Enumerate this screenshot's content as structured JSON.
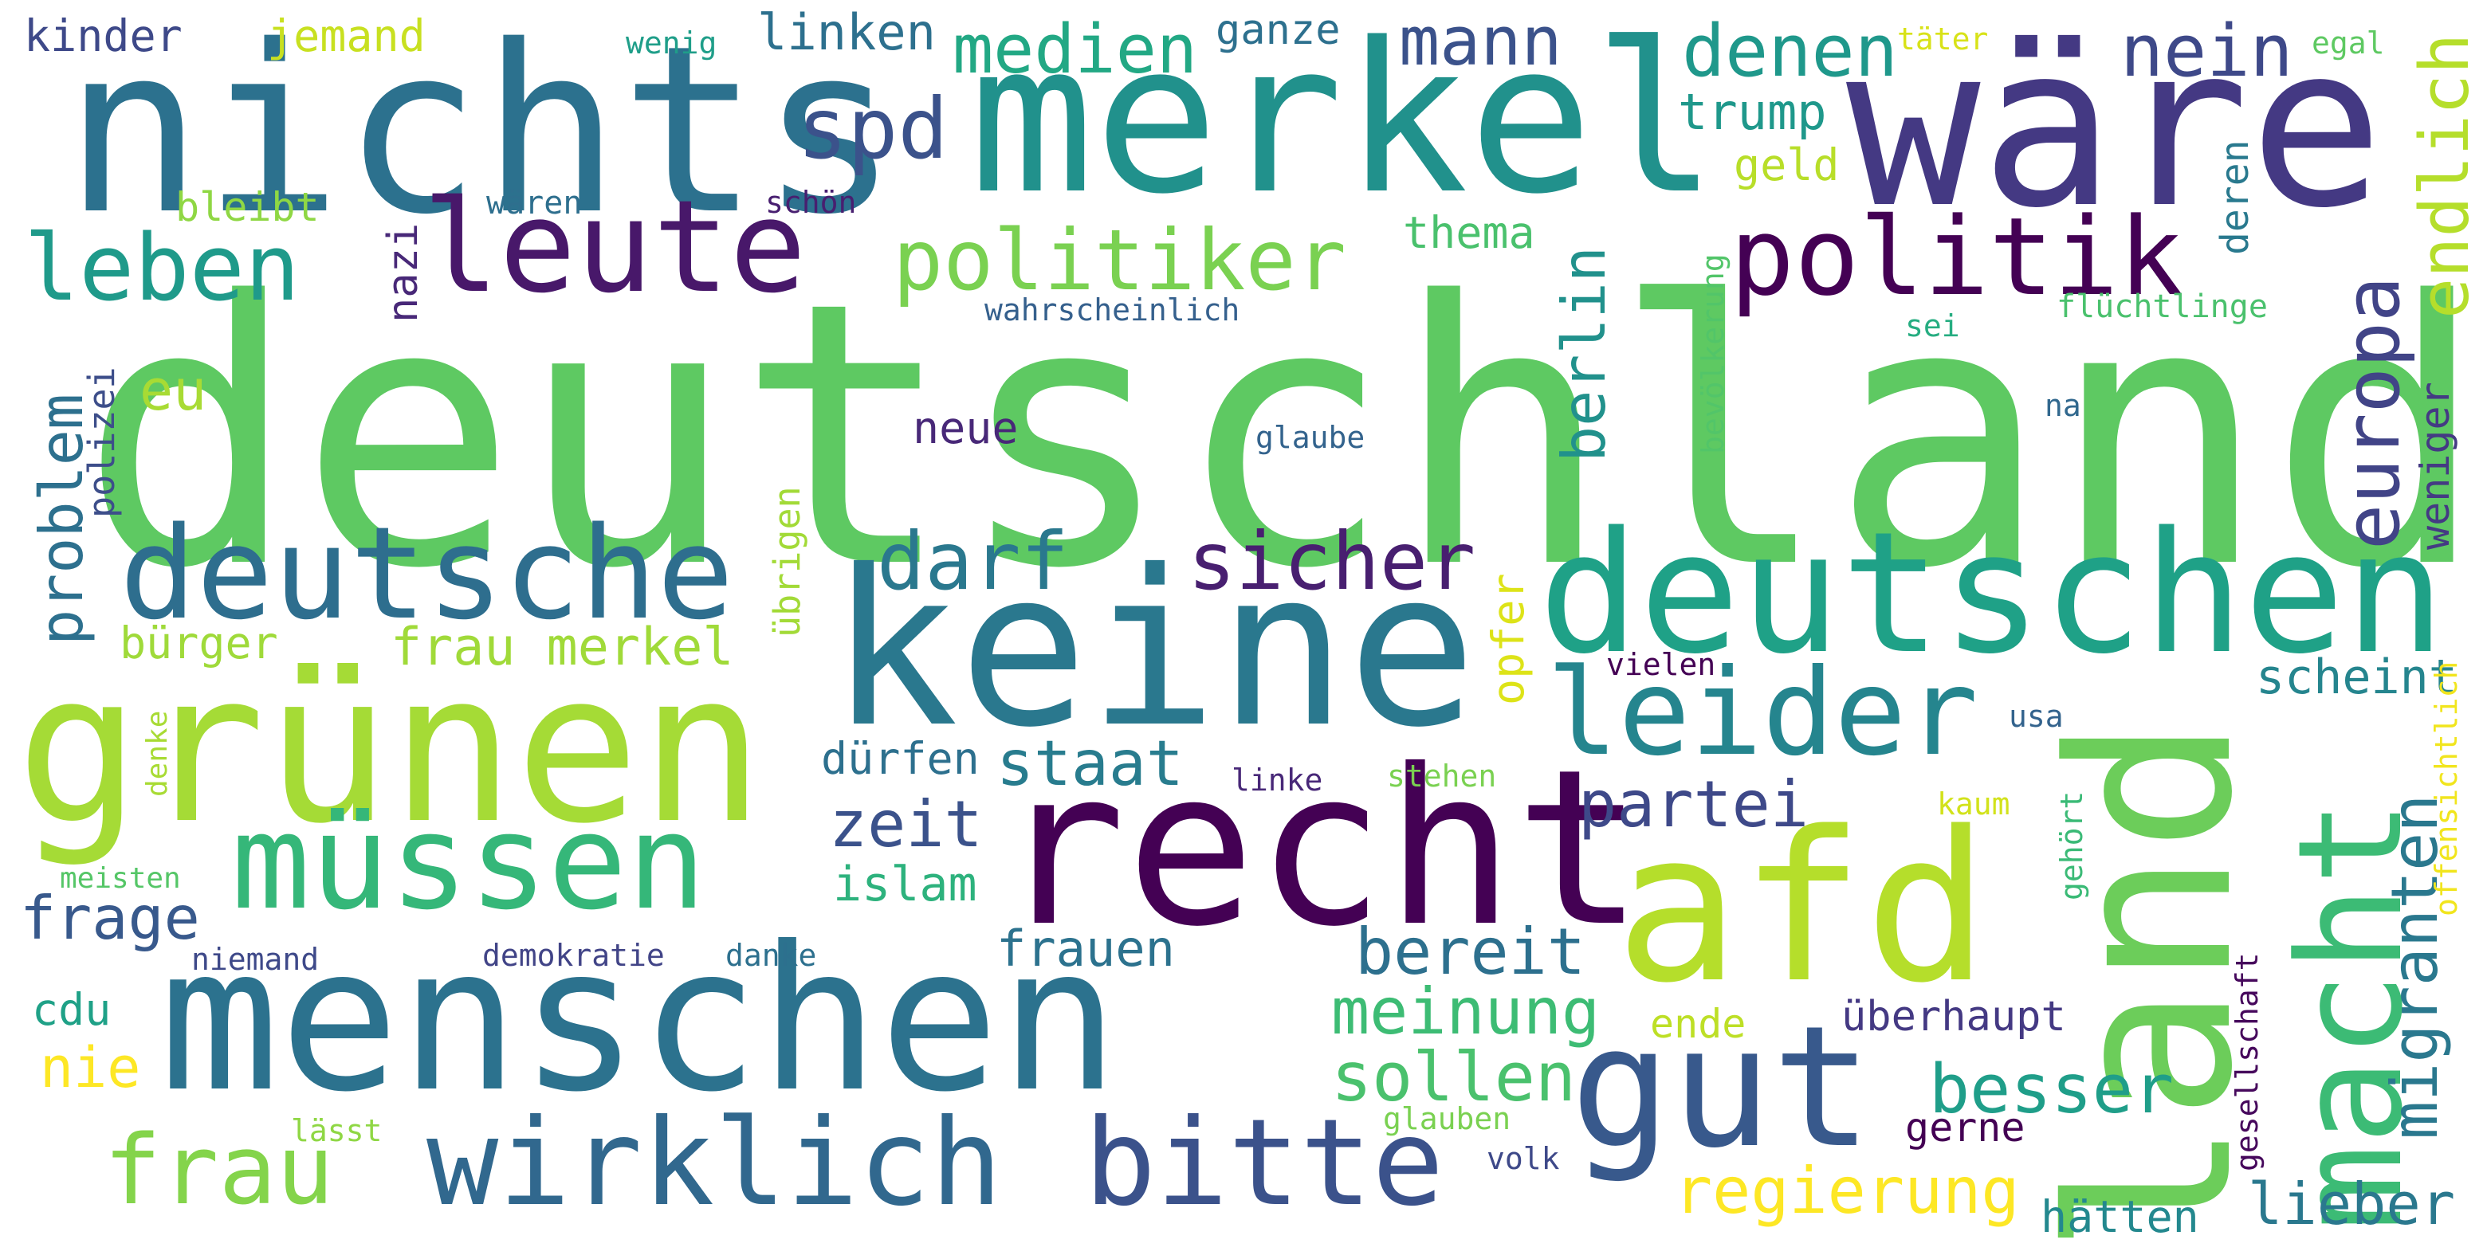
{
  "words": [
    {
      "text": "deutschland",
      "color": "#5ec962"
    },
    {
      "text": "wäre",
      "color": "#443983"
    },
    {
      "text": "nichts",
      "color": "#2c718e"
    },
    {
      "text": "merkel",
      "color": "#21918c"
    },
    {
      "text": "keine",
      "color": "#2a788e"
    },
    {
      "text": "recht",
      "color": "#440154"
    },
    {
      "text": "menschen",
      "color": "#2c728e"
    },
    {
      "text": "land",
      "color": "#6ccd5a"
    },
    {
      "text": "afd",
      "color": "#b5de2b"
    },
    {
      "text": "grünen",
      "color": "#a5db36"
    },
    {
      "text": "deutschen",
      "color": "#1fa187"
    },
    {
      "text": "deutsche",
      "color": "#2e6e8e"
    },
    {
      "text": "macht",
      "color": "#3cbb75"
    },
    {
      "text": "gut",
      "color": "#38598c"
    },
    {
      "text": "leute",
      "color": "#48186a"
    },
    {
      "text": "müssen",
      "color": "#35b779"
    },
    {
      "text": "wirklich",
      "color": "#31688e"
    },
    {
      "text": "bitte",
      "color": "#3b528b"
    },
    {
      "text": "politik",
      "color": "#440154"
    },
    {
      "text": "leider",
      "color": "#25858e"
    },
    {
      "text": "frau",
      "color": "#84d44b"
    },
    {
      "text": "politiker",
      "color": "#7ad151"
    },
    {
      "text": "leben",
      "color": "#1f9a8a"
    },
    {
      "text": "spd",
      "color": "#3b528b"
    },
    {
      "text": "darf",
      "color": "#2a788e"
    },
    {
      "text": "sicher",
      "color": "#481f70"
    },
    {
      "text": "europa",
      "color": "#414487"
    },
    {
      "text": "endlich",
      "color": "#b5de2b"
    },
    {
      "text": "migranten",
      "color": "#2a788e"
    },
    {
      "text": "denen",
      "color": "#1f988b"
    },
    {
      "text": "nein",
      "color": "#3e4989"
    },
    {
      "text": "medien",
      "color": "#22a884"
    },
    {
      "text": "mann",
      "color": "#3b528b"
    },
    {
      "text": "regierung",
      "color": "#fde725"
    },
    {
      "text": "besser",
      "color": "#1f9e89"
    },
    {
      "text": "sollen",
      "color": "#4ac16d"
    },
    {
      "text": "meinung",
      "color": "#3dbc74"
    },
    {
      "text": "bereit",
      "color": "#2d708e"
    },
    {
      "text": "partei",
      "color": "#3e4989"
    },
    {
      "text": "staat",
      "color": "#287c8e"
    },
    {
      "text": "zeit",
      "color": "#3b528b"
    },
    {
      "text": "frage",
      "color": "#38598c"
    },
    {
      "text": "problem",
      "color": "#2d708e"
    },
    {
      "text": "frau merkel",
      "color": "#a0da39"
    },
    {
      "text": "berlin",
      "color": "#21918c"
    },
    {
      "text": "lieber",
      "color": "#2a788e"
    },
    {
      "text": "trump",
      "color": "#1f988b"
    },
    {
      "text": "linken",
      "color": "#2d708e"
    },
    {
      "text": "scheint",
      "color": "#25858e"
    },
    {
      "text": "frauen",
      "color": "#2c728e"
    },
    {
      "text": "eu",
      "color": "#a8db34"
    },
    {
      "text": "bürger",
      "color": "#9fda3a"
    },
    {
      "text": "neue",
      "color": "#482878"
    },
    {
      "text": "kinder",
      "color": "#3e4989"
    },
    {
      "text": "jemand",
      "color": "#c8e020"
    },
    {
      "text": "ganze",
      "color": "#2d708e"
    },
    {
      "text": "islam",
      "color": "#2db27d"
    },
    {
      "text": "überhaupt",
      "color": "#443983"
    },
    {
      "text": "hätten",
      "color": "#23888e"
    },
    {
      "text": "nie",
      "color": "#fde725"
    },
    {
      "text": "cdu",
      "color": "#1fa187"
    },
    {
      "text": "dürfen",
      "color": "#2d708e"
    },
    {
      "text": "weniger",
      "color": "#443a83"
    },
    {
      "text": "opfer",
      "color": "#dde318"
    },
    {
      "text": "thema",
      "color": "#4ac16d"
    },
    {
      "text": "geld",
      "color": "#b8de29"
    },
    {
      "text": "nazi",
      "color": "#482878"
    },
    {
      "text": "bleibt",
      "color": "#8fd744"
    },
    {
      "text": "polizei",
      "color": "#3d4e8a"
    },
    {
      "text": "gerne",
      "color": "#440154"
    },
    {
      "text": "ende",
      "color": "#bddf26"
    },
    {
      "text": "deren",
      "color": "#29798e"
    },
    {
      "text": "übrigen",
      "color": "#a2da37"
    },
    {
      "text": "wahrscheinlich",
      "color": "#35608d"
    },
    {
      "text": "wären",
      "color": "#2e6f8e"
    },
    {
      "text": "schön",
      "color": "#481f70"
    },
    {
      "text": "wenig",
      "color": "#1f9e89"
    },
    {
      "text": "täter",
      "color": "#d8e219"
    },
    {
      "text": "egal",
      "color": "#5ec962"
    },
    {
      "text": "bevölkerung",
      "color": "#52c569"
    },
    {
      "text": "sei",
      "color": "#26ad81"
    },
    {
      "text": "flüchtlinge",
      "color": "#4ac16d"
    },
    {
      "text": "na",
      "color": "#31688e"
    },
    {
      "text": "glaube",
      "color": "#33638d"
    },
    {
      "text": "usa",
      "color": "#33638d"
    },
    {
      "text": "vielen",
      "color": "#440154"
    },
    {
      "text": "linke",
      "color": "#482878"
    },
    {
      "text": "stehen",
      "color": "#7ad151"
    },
    {
      "text": "offensichtlich",
      "color": "#f1e51d"
    },
    {
      "text": "gehört",
      "color": "#3aba76"
    },
    {
      "text": "kaum",
      "color": "#d2e21b"
    },
    {
      "text": "gesellschaft",
      "color": "#46085c"
    },
    {
      "text": "denke",
      "color": "#a8db34"
    },
    {
      "text": "meisten",
      "color": "#55c667"
    },
    {
      "text": "niemand",
      "color": "#3e4989"
    },
    {
      "text": "demokratie",
      "color": "#414487"
    },
    {
      "text": "danke",
      "color": "#2d708e"
    },
    {
      "text": "lässt",
      "color": "#8fd744"
    },
    {
      "text": "glauben",
      "color": "#7ad151"
    },
    {
      "text": "volk",
      "color": "#3e4989"
    }
  ]
}
